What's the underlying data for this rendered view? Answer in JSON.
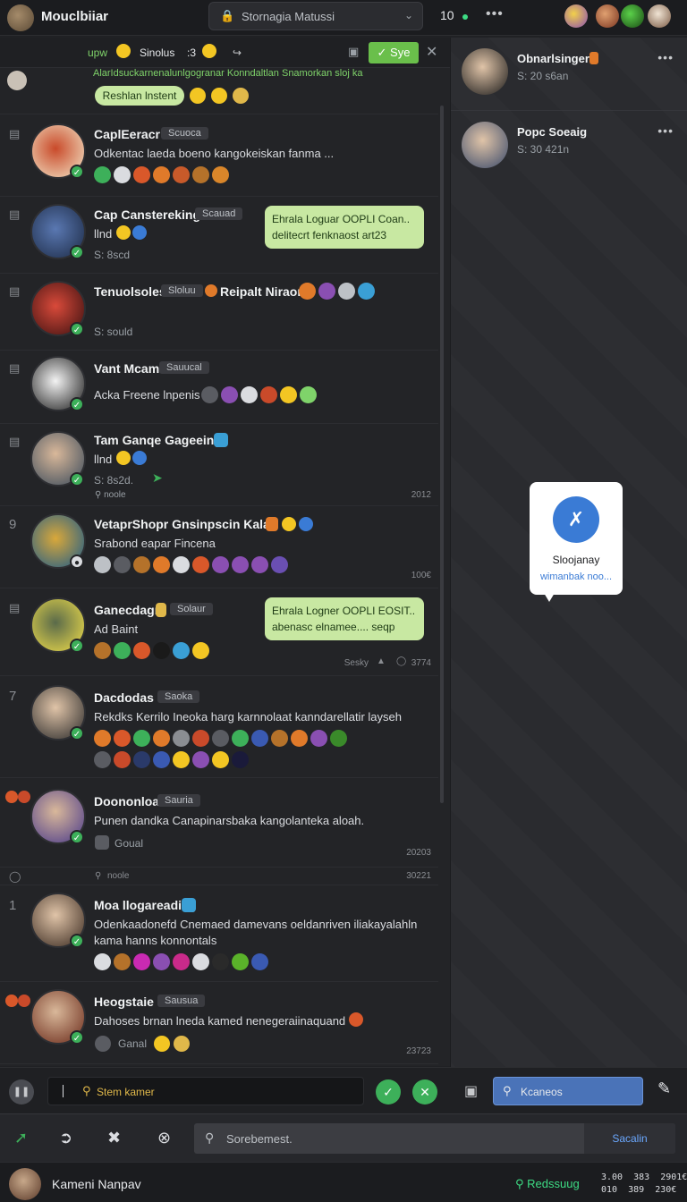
{
  "app": {
    "title": "Mouclbiiar"
  },
  "top_search": {
    "text": "Stornagia Matussi"
  },
  "top_bar": {
    "count": "10"
  },
  "filter_bar": {
    "label_a": "upw",
    "label_b": "Sinolus",
    "label_c": ":3",
    "save_label": "Sye"
  },
  "pinned": {
    "text": "AlarIdsuckarnenalunlgogranar Konndaltlan Snamorkan sloj ka",
    "pill_label": "Reshlan lnstent"
  },
  "chats": [
    {
      "name": "CaplEeracr",
      "tag": "Scuoca",
      "message": "Odkentac laeda boeno kangokeiskan fanma ...",
      "sub": "",
      "time": ""
    },
    {
      "name": "Cap Canstereking",
      "tag": "Scauad",
      "message": "llnd",
      "sub": "S: 8scd",
      "time": "",
      "bubble": [
        "Ehrala Loguar OOPLI Coan..",
        "delitecrt fenknaost  art23"
      ]
    },
    {
      "name": "Tenuolsoles",
      "tag": "Sloluu",
      "name_suffix": "Reipalt Niraom",
      "message": "",
      "sub": "S: sould",
      "time": ""
    },
    {
      "name": "Vant Mcam",
      "tag": "Sauucal",
      "message": "Acka Freene lnpenis",
      "sub": "",
      "time": ""
    },
    {
      "name": "Tam Ganqe Gageeing",
      "tag": "",
      "message": "llnd",
      "sub": "S: 8s2d.",
      "sub2": "noole",
      "time": "2012"
    },
    {
      "name": "VetaprShopr Gnsinpscin Kalan",
      "tag": "",
      "message": "Srabond eapar Fincena",
      "sub": "",
      "time": "100€"
    },
    {
      "name": "Ganecdagr",
      "tag": "Solaur",
      "message": "Ad Baint",
      "sub": "",
      "time": "3774",
      "time_b": "Sesky",
      "bubble": [
        "Ehrala Logner OOPLI EOSIT..",
        "abenasc elnamee....  seqp"
      ]
    },
    {
      "name": "Dacdodas",
      "tag": "Saoka",
      "message": "Rekdks Kerrilo Ineoka harg karnnolaat kanndarellatir layseh",
      "sub": "",
      "time": ""
    },
    {
      "name": "Doononloa",
      "tag": "Sauria",
      "message": "Punen dandka Canapinarsbaka kangolanteka aloah.",
      "sub": "Goual",
      "time": "20203"
    },
    {
      "name": "Moa llogareadiag",
      "tag": "",
      "message": "Odenkaadonefd Cnemaed damevans oeldanriven iliakayalahln",
      "message2": "kama hanns konnontals",
      "sub": "",
      "sub_top": "noole",
      "time": "30221"
    },
    {
      "name": "Heogstaie",
      "tag": "Sausua",
      "message": "Dahoses brnan lneda kamed nenegeraiinaquand",
      "sub": "Ganal",
      "time": "23723"
    }
  ],
  "composer": {
    "placeholder": "Stem kamer"
  },
  "contacts": [
    {
      "name": "Obnarlsinger",
      "status": "S: 20 s6an"
    },
    {
      "name": "Popc Soeaig",
      "status": "S: 30 421n"
    }
  ],
  "popup": {
    "title": "Sloojanay",
    "link": "wimanbak noo..."
  },
  "right_composer": {
    "placeholder": "Kcaneos"
  },
  "bottom_search": {
    "placeholder": "Sorebemest.",
    "button": "Sacalin"
  },
  "status_bar": {
    "user": "Kameni Nanpav",
    "ready": "Redssuug",
    "stats_line1": "3.00  383  2901€",
    "stats_line2": "010  389  230€"
  },
  "colors": {
    "accent_green": "#6abf4b",
    "bubble_green": "#c8e8a2",
    "link_blue": "#3a7bd5",
    "online": "#3ddc84"
  }
}
